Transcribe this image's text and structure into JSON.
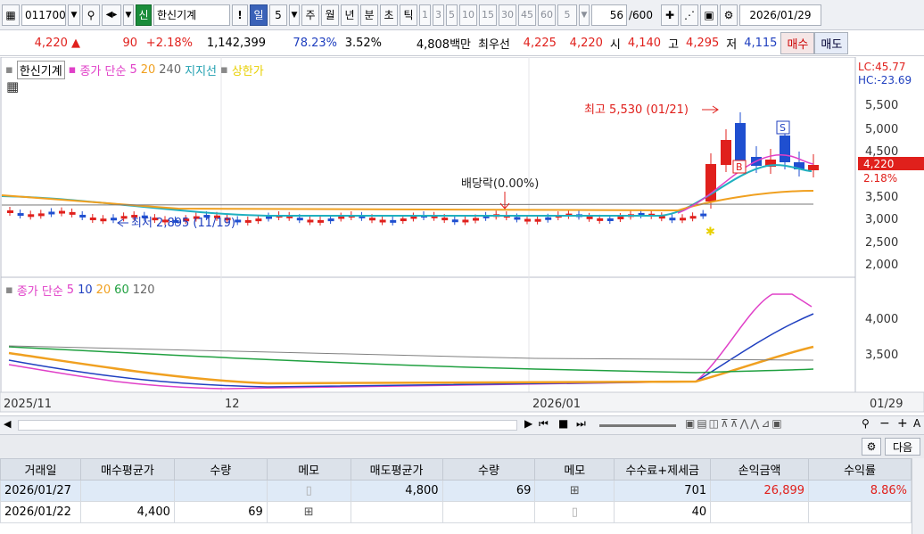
{
  "toolbar": {
    "code": "011700",
    "credit_badge": "신",
    "name": "한신기계",
    "excl": "!",
    "periods": [
      "일",
      "5",
      "주",
      "월",
      "년",
      "분",
      "초",
      "틱"
    ],
    "active_period": "일",
    "minutes": [
      "1",
      "3",
      "5",
      "10",
      "15",
      "30",
      "45",
      "60"
    ],
    "interval": "5",
    "count": "56",
    "count_max": "/600",
    "date": "2026/01/29"
  },
  "info": {
    "price": "4,220",
    "change": "90",
    "rate": "+2.18%",
    "volume": "1,142,399",
    "vol_ratio": "78.23%",
    "turnover": "3.52%",
    "amount": "4,808백만",
    "best_label": "최우선",
    "best_sell": "4,225",
    "best_buy": "4,220",
    "open_label": "시",
    "open": "4,140",
    "high_label": "고",
    "high": "4,295",
    "low_label": "저",
    "low": "4,115",
    "buy_btn": "매수",
    "sell_btn": "매도"
  },
  "price_panel": {
    "legend": [
      "한신기계",
      "종가 단순",
      "5",
      "20",
      "240",
      "지지선",
      "상한가"
    ],
    "lc": "LC:45.77",
    "hc": "HC:-23.69",
    "y_ticks": [
      "5,500",
      "5,000",
      "4,500",
      "3,500",
      "3,000",
      "2,500",
      "2,000"
    ],
    "last_price": "4,220",
    "last_rate": "2.18%",
    "max_label": "최고 5,530 (01/21)",
    "min_label": "최저 2,895 (11/19)",
    "dividend_label": "배당락(0.00%)",
    "marker_b": "B",
    "marker_s": "S",
    "star": "✱"
  },
  "ma_panel": {
    "legend": [
      "종가 단순",
      "5",
      "10",
      "20",
      "60",
      "120"
    ],
    "y_ticks": [
      "4,000",
      "3,500"
    ]
  },
  "x_axis": [
    "2025/11",
    "12",
    "2026/01",
    "01/29"
  ],
  "panel": {
    "next_btn": "다음"
  },
  "trades": {
    "headers": [
      "거래일",
      "매수평균가",
      "수량",
      "메모",
      "매도평균가",
      "수량",
      "메모",
      "수수료+제세금",
      "손익금액",
      "수익률"
    ],
    "rows": [
      [
        "2026/01/27",
        "",
        "",
        "",
        "4,800",
        "69",
        "",
        "701",
        "26,899",
        "8.86%"
      ],
      [
        "2026/01/22",
        "4,400",
        "69",
        "",
        "",
        "",
        "",
        "40",
        "",
        ""
      ]
    ]
  },
  "colors": {
    "up": "#e0201c",
    "down": "#1f4fd0",
    "ma5": "#e040c8",
    "ma10": "#2040c0",
    "ma20": "#f0a020",
    "ma60": "#20a040",
    "ma120": "#808080"
  }
}
